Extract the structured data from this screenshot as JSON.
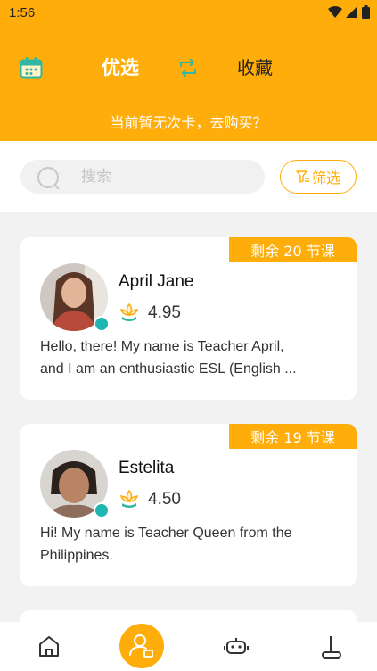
{
  "status": {
    "time": "1:56"
  },
  "nav": {
    "tab_active": "优选",
    "tab_fav": "收藏"
  },
  "notice": "当前暂无次卡，去购买？",
  "search": {
    "placeholder": "搜索"
  },
  "filter": {
    "label": "筛选"
  },
  "teachers": [
    {
      "remaining": "剩余 20 节课",
      "name": "April Jane",
      "rating": "4.95",
      "intro_line1": "Hello, there! My name is Teacher April,",
      "intro_line2": "and I am an enthusiastic ESL (English ..."
    },
    {
      "remaining": "剩余 19 节课",
      "name": "Estelita",
      "rating": "4.50",
      "intro_line1": "Hi! My name is Teacher Queen from the",
      "intro_line2": "Philippines."
    }
  ],
  "colors": {
    "accent": "#ffad0a",
    "badge_teal": "#1fb5b0"
  }
}
